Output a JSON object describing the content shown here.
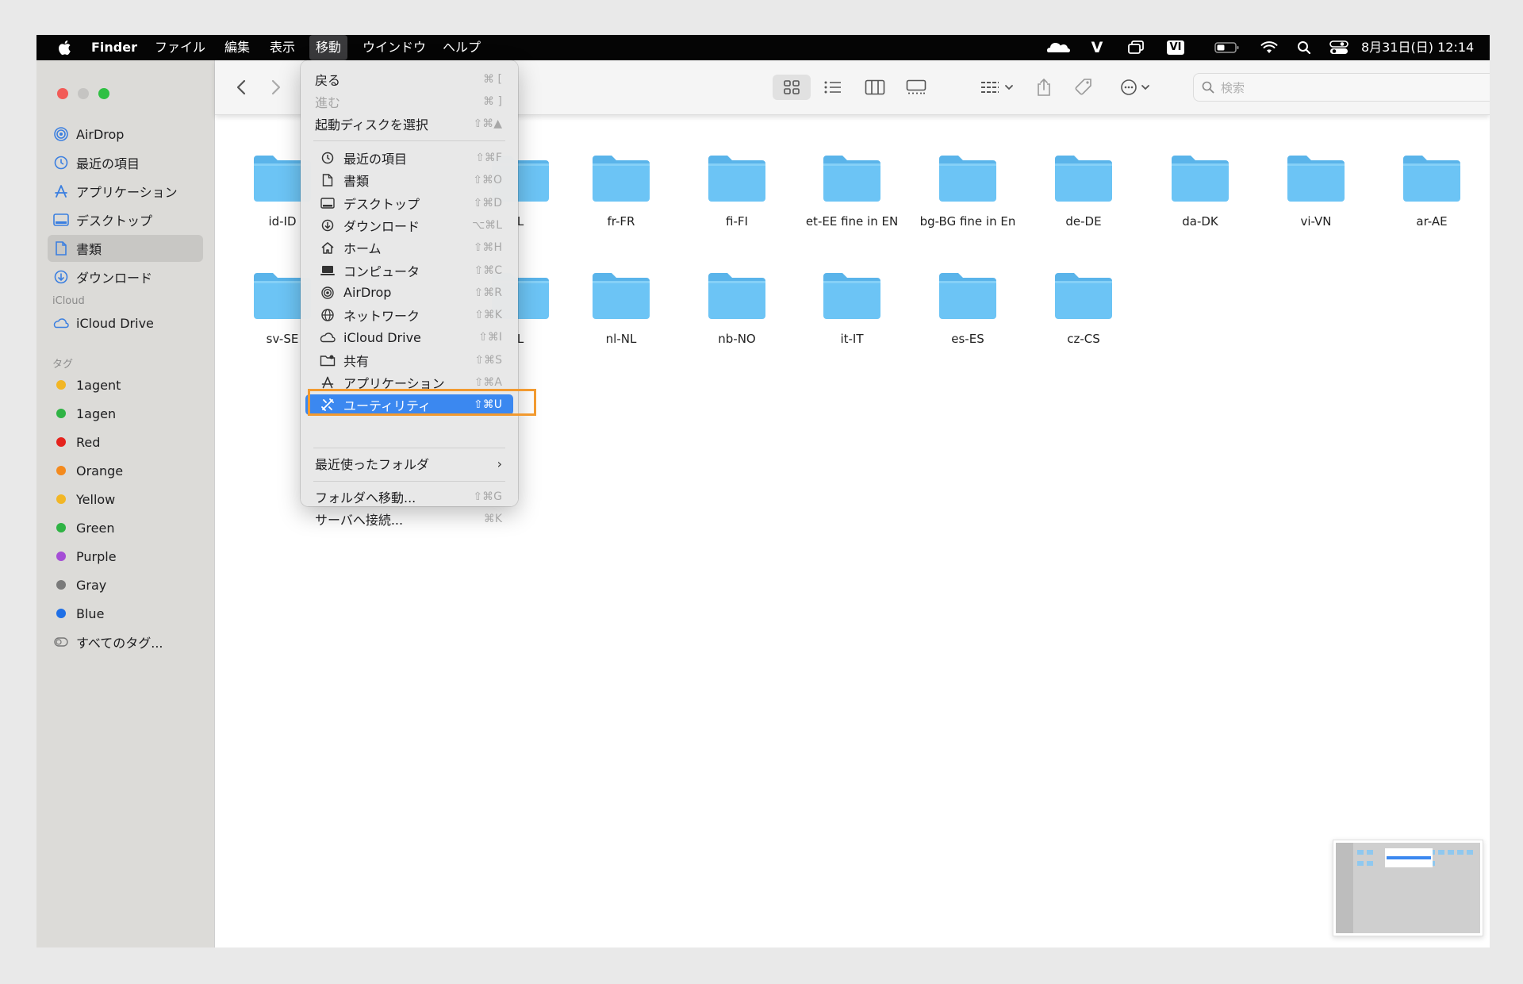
{
  "menubar": {
    "apple": "",
    "app_name": "Finder",
    "menus": [
      "ファイル",
      "編集",
      "表示",
      "移動",
      "ウインドウ",
      "ヘルプ"
    ],
    "vi_badge": "VI",
    "v_label": "V",
    "clock": "8月31日(日) 12:14"
  },
  "sidebar": {
    "favorites": [
      {
        "label": "AirDrop",
        "icon": "airdrop-icon"
      },
      {
        "label": "最近の項目",
        "icon": "clock-icon"
      },
      {
        "label": "アプリケーション",
        "icon": "apps-icon"
      },
      {
        "label": "デスクトップ",
        "icon": "desktop-icon"
      },
      {
        "label": "書類",
        "icon": "document-icon",
        "selected": true
      },
      {
        "label": "ダウンロード",
        "icon": "download-icon"
      }
    ],
    "icloud_header": "iCloud",
    "icloud_drive": "iCloud Drive",
    "tags_header": "タグ",
    "tags": [
      {
        "label": "1agent",
        "color": "#f2b625"
      },
      {
        "label": "1agen",
        "color": "#2fb344"
      },
      {
        "label": "Red",
        "color": "#e5231d"
      },
      {
        "label": "Orange",
        "color": "#f48a1d"
      },
      {
        "label": "Yellow",
        "color": "#f2b625"
      },
      {
        "label": "Green",
        "color": "#2fb344"
      },
      {
        "label": "Purple",
        "color": "#a54ed6"
      },
      {
        "label": "Gray",
        "color": "#7a7a7a"
      },
      {
        "label": "Blue",
        "color": "#1f6fe6"
      }
    ],
    "all_tags": "すべてのタグ..."
  },
  "toolbar": {
    "search_placeholder": "検索"
  },
  "folders": {
    "row1": [
      "id-ID",
      "L",
      "fr-FR",
      "fi-FI",
      "et-EE fine in EN",
      "bg-BG fine in En",
      "de-DE",
      "da-DK",
      "vi-VN",
      "ar-AE"
    ],
    "row2": [
      "sv-SE",
      "L",
      "nl-NL",
      "nb-NO",
      "it-IT",
      "es-ES",
      "cz-CS"
    ]
  },
  "go_menu": {
    "back": {
      "label": "戻る",
      "shortcut": "⌘ ["
    },
    "forward": {
      "label": "進む",
      "shortcut": "⌘ ]"
    },
    "startup": {
      "label": "起動ディスクを選択",
      "shortcut": "⇧⌘▲"
    },
    "items": [
      {
        "label": "最近の項目",
        "shortcut": "⇧⌘F",
        "icon": "clock-icon"
      },
      {
        "label": "書類",
        "shortcut": "⇧⌘O",
        "icon": "document-icon"
      },
      {
        "label": "デスクトップ",
        "shortcut": "⇧⌘D",
        "icon": "desktop-icon"
      },
      {
        "label": "ダウンロード",
        "shortcut": "⌥⌘L",
        "icon": "download-icon"
      },
      {
        "label": "ホーム",
        "shortcut": "⇧⌘H",
        "icon": "home-icon"
      },
      {
        "label": "コンピュータ",
        "shortcut": "⇧⌘C",
        "icon": "laptop-icon"
      },
      {
        "label": "AirDrop",
        "shortcut": "⇧⌘R",
        "icon": "airdrop-icon"
      },
      {
        "label": "ネットワーク",
        "shortcut": "⇧⌘K",
        "icon": "network-icon"
      },
      {
        "label": "iCloud Drive",
        "shortcut": "⇧⌘I",
        "icon": "cloud-icon"
      },
      {
        "label": "共有",
        "shortcut": "⇧⌘S",
        "icon": "shared-folder-icon"
      },
      {
        "label": "アプリケーション",
        "shortcut": "⇧⌘A",
        "icon": "apps-icon"
      },
      {
        "label": "ユーティリティ",
        "shortcut": "⇧⌘U",
        "icon": "utilities-icon"
      }
    ],
    "recent_folders": "最近使ったフォルダ",
    "go_to_folder": {
      "label": "フォルダへ移動...",
      "shortcut": "⇧⌘G"
    },
    "connect_server": {
      "label": "サーバへ接続...",
      "shortcut": "⌘K"
    }
  },
  "colors": {
    "menu_highlight": "#3b88f0",
    "annotation_box": "#f29a30",
    "folder_blue": "#6cc4f5"
  }
}
